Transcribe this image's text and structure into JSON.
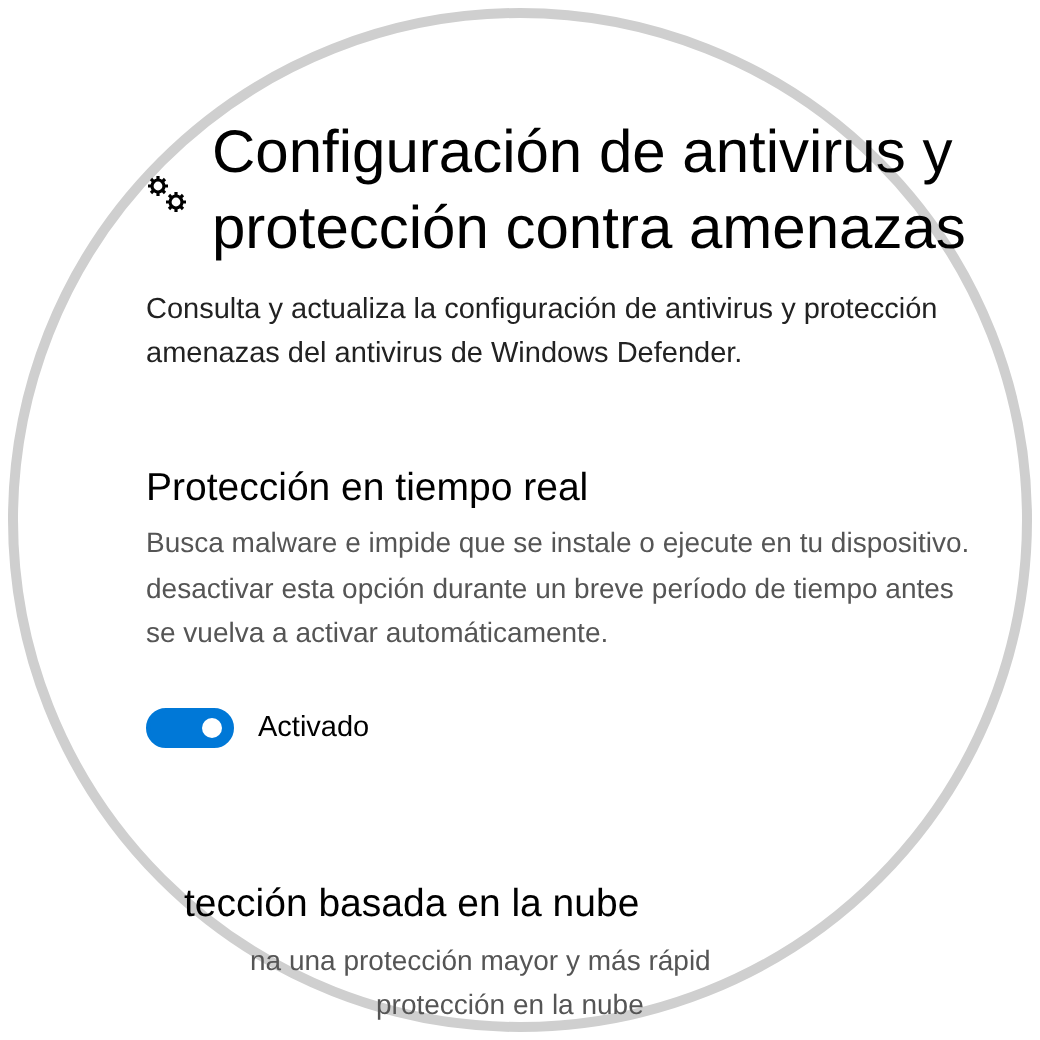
{
  "page": {
    "title_lines": [
      "Configuración de antivirus y",
      "protección contra amenazas"
    ],
    "description_lines": [
      "Consulta y actualiza la configuración de antivirus y protección",
      "amenazas del antivirus de Windows Defender."
    ]
  },
  "sections": [
    {
      "heading": "Protección en tiempo real",
      "lines": [
        "Busca malware e impide que se instale o ejecute en tu dispositivo.",
        "desactivar esta opción durante un breve período de tiempo antes",
        "se vuelva a activar automáticamente."
      ],
      "toggle": {
        "on": true,
        "label": "Activado"
      }
    },
    {
      "heading": "tección basada en la nube",
      "lines": [
        "na una protección mayor y más rápid",
        "protección en la nube"
      ]
    }
  ]
}
